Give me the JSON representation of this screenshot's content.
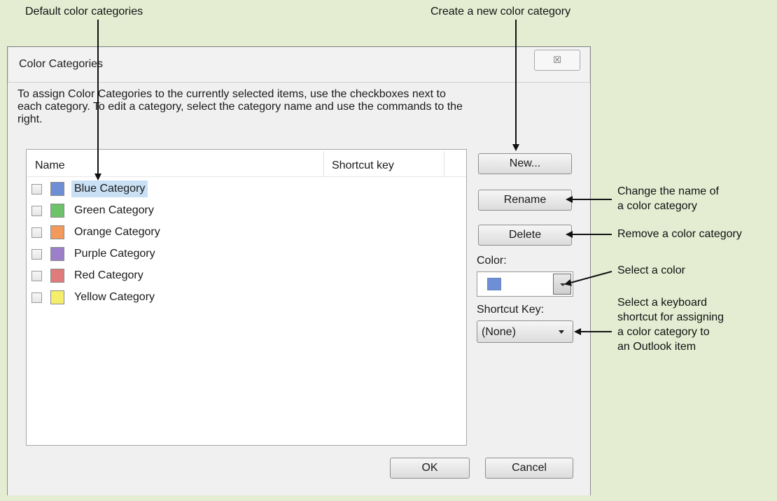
{
  "callouts": {
    "default_categories": "Default color categories",
    "create_new": "Create a new color category",
    "change_name_line1": "Change the name of",
    "change_name_line2": "a color category",
    "remove": "Remove a color category",
    "select_color": "Select a color",
    "shortcut_line1": "Select a keyboard",
    "shortcut_line2": "shortcut for assigning",
    "shortcut_line3": "a color category to",
    "shortcut_line4": "an Outlook item"
  },
  "dialog": {
    "title": "Color Categories",
    "close_glyph": "☒",
    "instructions_line1": "To assign Color Categories to the currently selected items, use the checkboxes next to",
    "instructions_line2": "each category.  To edit a category, select the category name and use the commands to the",
    "instructions_line3": "right."
  },
  "list": {
    "col_name": "Name",
    "col_shortcut": "Shortcut key",
    "items": [
      {
        "label": "Blue Category",
        "color": "#6e8fd6",
        "checked": false,
        "selected": true
      },
      {
        "label": "Green Category",
        "color": "#6cc36a",
        "checked": false,
        "selected": false
      },
      {
        "label": "Orange Category",
        "color": "#f29a5c",
        "checked": false,
        "selected": false
      },
      {
        "label": "Purple Category",
        "color": "#9b7fc9",
        "checked": false,
        "selected": false
      },
      {
        "label": "Red Category",
        "color": "#e07b7b",
        "checked": false,
        "selected": false
      },
      {
        "label": "Yellow Category",
        "color": "#f5ee6a",
        "checked": false,
        "selected": false
      }
    ]
  },
  "buttons": {
    "new": "New...",
    "rename": "Rename",
    "delete": "Delete",
    "ok": "OK",
    "cancel": "Cancel"
  },
  "color_picker": {
    "label": "Color:",
    "selected_color": "#6e8fd6"
  },
  "shortcut": {
    "label": "Shortcut Key:",
    "value": "(None)"
  },
  "colors": {
    "background": "#e4edd2",
    "selection": "#c9e0f5"
  }
}
